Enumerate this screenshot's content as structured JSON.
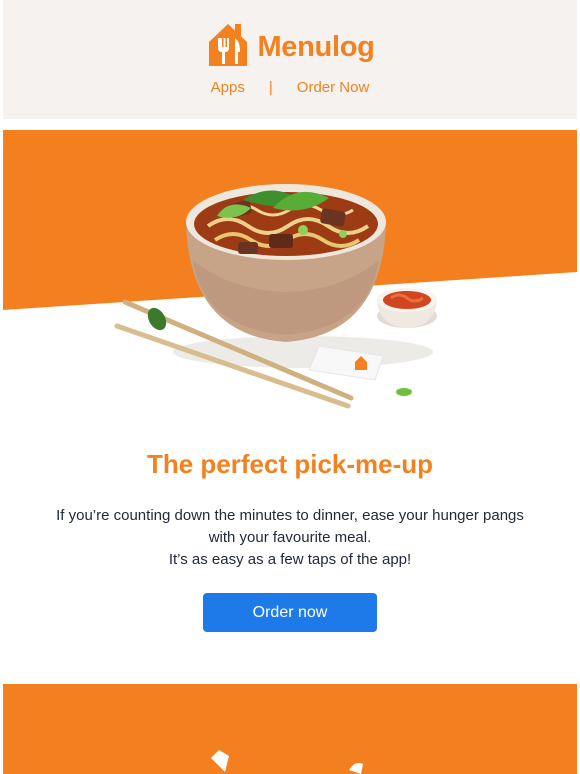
{
  "brand": {
    "name": "Menulog",
    "logo_icon": "house-fork-knife-icon",
    "color": "#f3811f"
  },
  "nav": {
    "items": [
      {
        "label": "Apps"
      },
      {
        "label": "Order Now"
      }
    ],
    "separator": "|"
  },
  "hero": {
    "image": "noodle-bowl-photo",
    "background_color": "#f47f1f"
  },
  "content": {
    "headline": "The perfect pick-me-up",
    "body_lines": [
      "If you’re counting down the minutes to dinner, ease your hunger pangs",
      "with your favourite meal.",
      "It’s as easy as a few taps of the app!"
    ]
  },
  "cta": {
    "label": "Order now",
    "color": "#1f7ae9"
  }
}
